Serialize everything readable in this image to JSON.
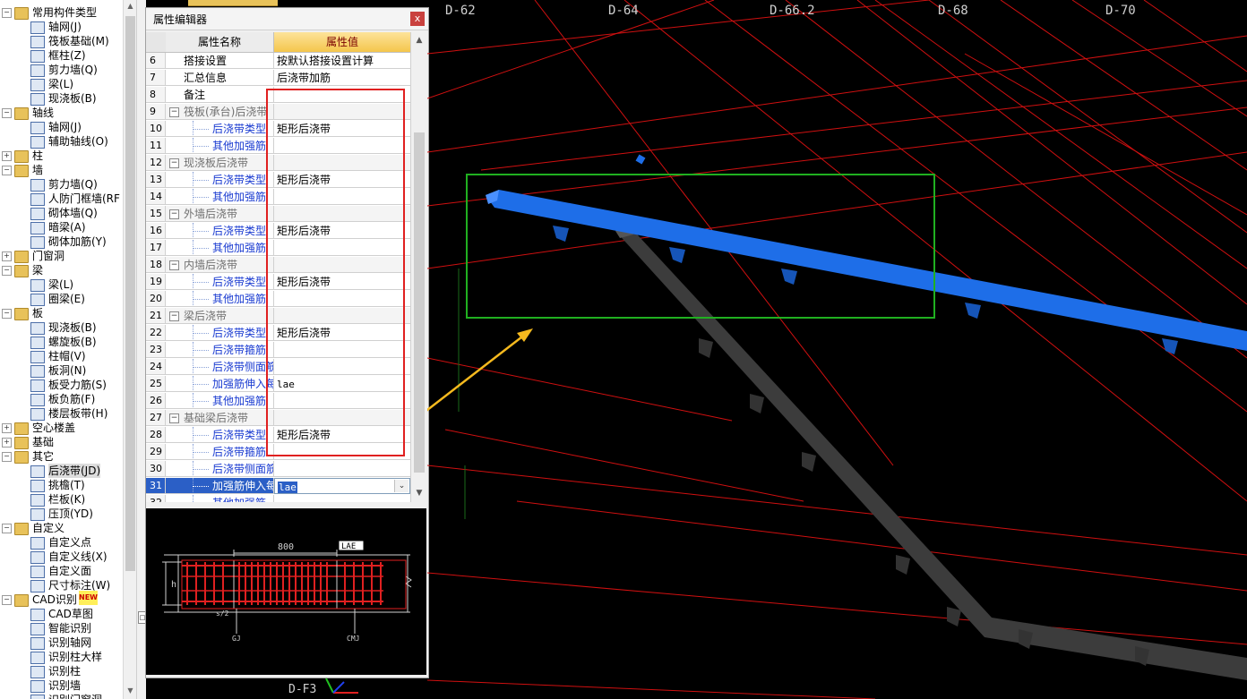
{
  "tree": {
    "items": [
      {
        "label": "常用构件类型",
        "kind": "folder",
        "level": 0,
        "expanded": true
      },
      {
        "label": "轴网(J)",
        "kind": "leaf",
        "level": 1
      },
      {
        "label": "筏板基础(M)",
        "kind": "leaf",
        "level": 1
      },
      {
        "label": "框柱(Z)",
        "kind": "leaf",
        "level": 1
      },
      {
        "label": "剪力墙(Q)",
        "kind": "leaf",
        "level": 1
      },
      {
        "label": "梁(L)",
        "kind": "leaf",
        "level": 1
      },
      {
        "label": "现浇板(B)",
        "kind": "leaf",
        "level": 1
      },
      {
        "label": "轴线",
        "kind": "folder",
        "level": 0,
        "expanded": true
      },
      {
        "label": "轴网(J)",
        "kind": "leaf",
        "level": 1
      },
      {
        "label": "辅助轴线(O)",
        "kind": "leaf",
        "level": 1
      },
      {
        "label": "柱",
        "kind": "folder",
        "level": 0,
        "expanded": false
      },
      {
        "label": "墙",
        "kind": "folder",
        "level": 0,
        "expanded": true
      },
      {
        "label": "剪力墙(Q)",
        "kind": "leaf",
        "level": 1
      },
      {
        "label": "人防门框墙(RF",
        "kind": "leaf",
        "level": 1
      },
      {
        "label": "砌体墙(Q)",
        "kind": "leaf",
        "level": 1
      },
      {
        "label": "暗梁(A)",
        "kind": "leaf",
        "level": 1
      },
      {
        "label": "砌体加筋(Y)",
        "kind": "leaf",
        "level": 1
      },
      {
        "label": "门窗洞",
        "kind": "folder",
        "level": 0,
        "expanded": false
      },
      {
        "label": "梁",
        "kind": "folder",
        "level": 0,
        "expanded": true
      },
      {
        "label": "梁(L)",
        "kind": "leaf",
        "level": 1
      },
      {
        "label": "圈梁(E)",
        "kind": "leaf",
        "level": 1
      },
      {
        "label": "板",
        "kind": "folder",
        "level": 0,
        "expanded": true
      },
      {
        "label": "现浇板(B)",
        "kind": "leaf",
        "level": 1
      },
      {
        "label": "螺旋板(B)",
        "kind": "leaf",
        "level": 1
      },
      {
        "label": "柱帽(V)",
        "kind": "leaf",
        "level": 1
      },
      {
        "label": "板洞(N)",
        "kind": "leaf",
        "level": 1
      },
      {
        "label": "板受力筋(S)",
        "kind": "leaf",
        "level": 1
      },
      {
        "label": "板负筋(F)",
        "kind": "leaf",
        "level": 1
      },
      {
        "label": "楼层板带(H)",
        "kind": "leaf",
        "level": 1
      },
      {
        "label": "空心楼盖",
        "kind": "folder",
        "level": 0,
        "expanded": false
      },
      {
        "label": "基础",
        "kind": "folder",
        "level": 0,
        "expanded": false
      },
      {
        "label": "其它",
        "kind": "folder",
        "level": 0,
        "expanded": true
      },
      {
        "label": "后浇带(JD)",
        "kind": "leaf",
        "level": 1,
        "selected": true
      },
      {
        "label": "挑檐(T)",
        "kind": "leaf",
        "level": 1
      },
      {
        "label": "栏板(K)",
        "kind": "leaf",
        "level": 1
      },
      {
        "label": "压顶(YD)",
        "kind": "leaf",
        "level": 1
      },
      {
        "label": "自定义",
        "kind": "folder",
        "level": 0,
        "expanded": true
      },
      {
        "label": "自定义点",
        "kind": "leaf",
        "level": 1
      },
      {
        "label": "自定义线(X)",
        "kind": "leaf",
        "level": 1
      },
      {
        "label": "自定义面",
        "kind": "leaf",
        "level": 1
      },
      {
        "label": "尺寸标注(W)",
        "kind": "leaf",
        "level": 1
      },
      {
        "label": "CAD识别",
        "kind": "folder",
        "level": 0,
        "expanded": true,
        "badge": "NEW"
      },
      {
        "label": "CAD草图",
        "kind": "leaf",
        "level": 1
      },
      {
        "label": "智能识别",
        "kind": "leaf",
        "level": 1
      },
      {
        "label": "识别轴网",
        "kind": "leaf",
        "level": 1
      },
      {
        "label": "识别柱大样",
        "kind": "leaf",
        "level": 1
      },
      {
        "label": "识别柱",
        "kind": "leaf",
        "level": 1
      },
      {
        "label": "识别墙",
        "kind": "leaf",
        "level": 1
      },
      {
        "label": "识别门窗洞",
        "kind": "leaf",
        "level": 1
      }
    ]
  },
  "editor": {
    "title": "属性编辑器",
    "close_label": "x",
    "col_name": "属性名称",
    "col_value": "属性值",
    "rows": [
      {
        "num": "6",
        "name": "搭接设置",
        "value": "按默认搭接设置计算",
        "type": "plain"
      },
      {
        "num": "7",
        "name": "汇总信息",
        "value": "后浇带加筋",
        "type": "plain"
      },
      {
        "num": "8",
        "name": "备注",
        "value": "",
        "type": "plain"
      },
      {
        "num": "9",
        "name": "筏板(承台)后浇带",
        "value": "",
        "type": "group"
      },
      {
        "num": "10",
        "name": "后浇带类型",
        "value": "矩形后浇带",
        "type": "child"
      },
      {
        "num": "11",
        "name": "其他加强筋",
        "value": "",
        "type": "child"
      },
      {
        "num": "12",
        "name": "现浇板后浇带",
        "value": "",
        "type": "group"
      },
      {
        "num": "13",
        "name": "后浇带类型",
        "value": "矩形后浇带",
        "type": "child"
      },
      {
        "num": "14",
        "name": "其他加强筋",
        "value": "",
        "type": "child"
      },
      {
        "num": "15",
        "name": "外墙后浇带",
        "value": "",
        "type": "group"
      },
      {
        "num": "16",
        "name": "后浇带类型",
        "value": "矩形后浇带",
        "type": "child"
      },
      {
        "num": "17",
        "name": "其他加强筋",
        "value": "",
        "type": "child"
      },
      {
        "num": "18",
        "name": "内墙后浇带",
        "value": "",
        "type": "group"
      },
      {
        "num": "19",
        "name": "后浇带类型",
        "value": "矩形后浇带",
        "type": "child"
      },
      {
        "num": "20",
        "name": "其他加强筋",
        "value": "",
        "type": "child"
      },
      {
        "num": "21",
        "name": "梁后浇带",
        "value": "",
        "type": "group"
      },
      {
        "num": "22",
        "name": "后浇带类型",
        "value": "矩形后浇带",
        "type": "child"
      },
      {
        "num": "23",
        "name": "后浇带箍筋",
        "value": "",
        "type": "child"
      },
      {
        "num": "24",
        "name": "后浇带侧面筋",
        "value": "",
        "type": "child"
      },
      {
        "num": "25",
        "name": "加强筋伸入每侧",
        "value": "lae",
        "type": "child"
      },
      {
        "num": "26",
        "name": "其他加强筋",
        "value": "",
        "type": "child"
      },
      {
        "num": "27",
        "name": "基础梁后浇带",
        "value": "",
        "type": "group"
      },
      {
        "num": "28",
        "name": "后浇带类型",
        "value": "矩形后浇带",
        "type": "child"
      },
      {
        "num": "29",
        "name": "后浇带箍筋",
        "value": "",
        "type": "child"
      },
      {
        "num": "30",
        "name": "后浇带侧面筋",
        "value": "",
        "type": "child"
      },
      {
        "num": "31",
        "name": "加强筋伸入每侧",
        "value": "lae",
        "type": "active"
      },
      {
        "num": "32",
        "name": "其他加强筋",
        "value": "",
        "type": "child"
      }
    ]
  },
  "preview": {
    "dim_label": "800",
    "tag_label": "LAE",
    "h_label": "h",
    "left_label": "GJ",
    "right_label": "CMJ",
    "sub_label": "s/2"
  },
  "cad": {
    "axis_labels": [
      "D-62",
      "D-64",
      "D-66.2",
      "D-68",
      "D-70"
    ],
    "bottom_label": "D-F3",
    "beam_color": "#1e6ee8",
    "beam2_color": "#3c3c3c"
  },
  "colors": {
    "highlight_red": "#e02020",
    "highlight_green": "#20b020",
    "arrow": "#f5b91e"
  }
}
